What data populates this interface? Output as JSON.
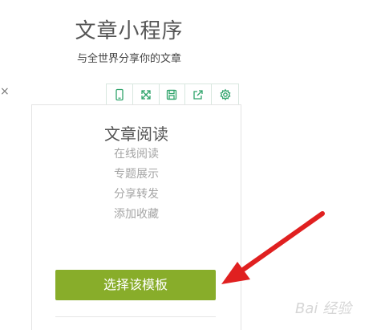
{
  "header": {
    "title": "文章小程序",
    "subtitle": "与全世界分享你的文章"
  },
  "left_edge": {
    "glyph": "×"
  },
  "toolbar": {
    "icons": [
      "phone-icon",
      "expand-icon",
      "save-icon",
      "share-icon",
      "settings-icon"
    ],
    "accent": "#2fa36b"
  },
  "card": {
    "title": "文章阅读",
    "features": [
      "在线阅读",
      "专题展示",
      "分享转发",
      "添加收藏"
    ]
  },
  "actions": {
    "select_label": "选择该模板",
    "button_color": "#88ad2a"
  },
  "annotation": {
    "arrow_color": "#e02020"
  },
  "watermark": {
    "text": "Bai 经验"
  }
}
